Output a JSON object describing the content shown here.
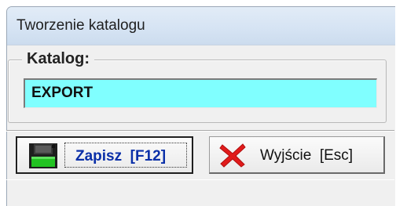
{
  "window": {
    "title": "Tworzenie katalogu"
  },
  "catalog_group": {
    "legend": "Katalog:",
    "value": "EXPORT",
    "field_color": "#80ffff"
  },
  "buttons": {
    "save": {
      "label": "Zapisz  [F12]",
      "icon": "floppy-disk-icon",
      "color": "#0a2fa8"
    },
    "exit": {
      "label": "Wyjście  [Esc]",
      "icon": "red-x-icon",
      "color": "#e11b1b"
    }
  }
}
